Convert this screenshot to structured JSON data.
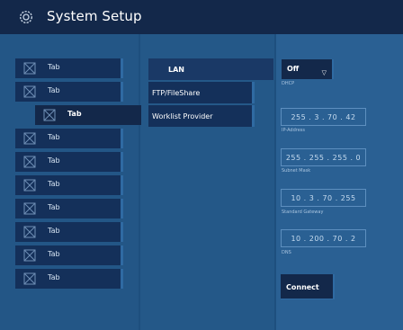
{
  "window": {
    "title": "System Setup",
    "icon": "gear-icon"
  },
  "left_tabs": [
    {
      "label": "Tab",
      "icon": "image-placeholder-icon",
      "active": false
    },
    {
      "label": "Tab",
      "icon": "image-placeholder-icon",
      "active": false
    },
    {
      "label": "Tab",
      "icon": "image-placeholder-icon",
      "active": true
    },
    {
      "label": "Tab",
      "icon": "image-placeholder-icon",
      "active": false
    },
    {
      "label": "Tab",
      "icon": "image-placeholder-icon",
      "active": false
    },
    {
      "label": "Tab",
      "icon": "image-placeholder-icon",
      "active": false
    },
    {
      "label": "Tab",
      "icon": "image-placeholder-icon",
      "active": false
    },
    {
      "label": "Tab",
      "icon": "image-placeholder-icon",
      "active": false
    },
    {
      "label": "Tab",
      "icon": "image-placeholder-icon",
      "active": false
    },
    {
      "label": "Tab",
      "icon": "image-placeholder-icon",
      "active": false
    }
  ],
  "middle_tabs": [
    {
      "label": "LAN",
      "active": true
    },
    {
      "label": "FTP/FileShare",
      "active": false
    },
    {
      "label": "Worklist Provider",
      "active": false
    }
  ],
  "dhcp": {
    "value": "Off",
    "label": "DHCP"
  },
  "fields": [
    {
      "value": "255 . 3 . 70 . 42",
      "label": "IP-Address"
    },
    {
      "value": "255 . 255 . 255 . 0",
      "label": "Subnet Mask"
    },
    {
      "value": "10 . 3 . 70 . 255",
      "label": "Standard Gateway"
    },
    {
      "value": "10 . 200 . 70 . 2",
      "label": "DNS"
    }
  ],
  "connect_label": "Connect",
  "colors": {
    "titlebar": "#13284a",
    "background": "#1e4f7e",
    "button": "#13284a",
    "accent": "#2f6aa2"
  }
}
